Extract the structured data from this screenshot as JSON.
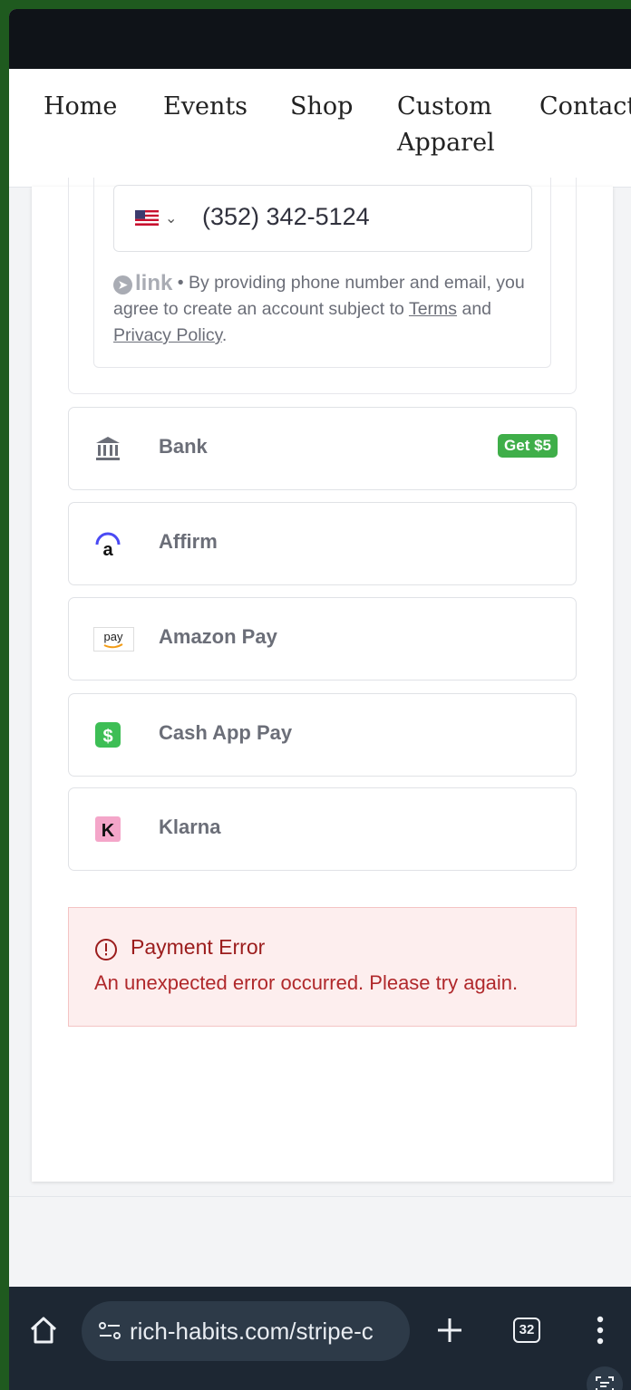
{
  "nav": {
    "items": [
      {
        "label": "Home"
      },
      {
        "label": "Events"
      },
      {
        "label": "Shop"
      },
      {
        "label": "Custom"
      },
      {
        "label": "Apparel"
      },
      {
        "label": "Contact"
      }
    ]
  },
  "link_form": {
    "country_flag": "us-flag-icon",
    "phone_value": "(352) 342-5124",
    "brand": "link",
    "consent_prefix": "• By providing phone number and email, you agree to create an account subject to",
    "terms_label": "Terms",
    "and_text": "and",
    "privacy_label": "Privacy Policy",
    "period": "."
  },
  "payment_methods": [
    {
      "label": "Bank",
      "icon": "bank-icon",
      "badge": "Get $5"
    },
    {
      "label": "Affirm",
      "icon": "affirm-icon"
    },
    {
      "label": "Amazon Pay",
      "icon": "amazon-pay-icon",
      "icon_text": "pay"
    },
    {
      "label": "Cash App Pay",
      "icon": "cash-app-icon",
      "icon_text": "$"
    },
    {
      "label": "Klarna",
      "icon": "klarna-icon",
      "icon_text": "K"
    }
  ],
  "error": {
    "title": "Payment Error",
    "message": "An unexpected error occurred. Please try again."
  },
  "browser": {
    "url": "rich-habits.com/stripe-c",
    "tab_count": "32"
  },
  "colors": {
    "accent_green": "#3fae49",
    "error_text": "#9b1c1c",
    "error_bg": "#fdeeee"
  }
}
